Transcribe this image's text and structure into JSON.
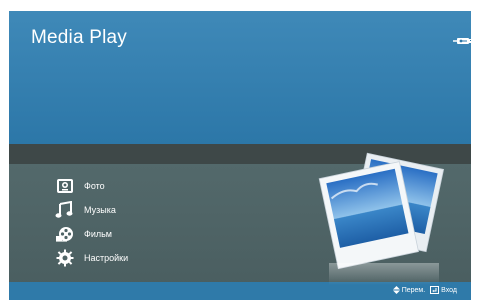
{
  "header": {
    "title": "Media Play",
    "usb_icon": "usb-icon"
  },
  "menu": {
    "items": [
      {
        "label": "Фото",
        "icon": "photo-icon"
      },
      {
        "label": "Музыка",
        "icon": "music-icon"
      },
      {
        "label": "Фильм",
        "icon": "film-icon"
      },
      {
        "label": "Настройки",
        "icon": "settings-icon"
      }
    ]
  },
  "footer": {
    "move_label": "Перем.",
    "enter_label": "Вход"
  },
  "colors": {
    "top_panel": "#2c77a8",
    "bottom_panel": "#4f6466",
    "footer_bar": "#2f7aa9",
    "text": "#ffffff"
  }
}
